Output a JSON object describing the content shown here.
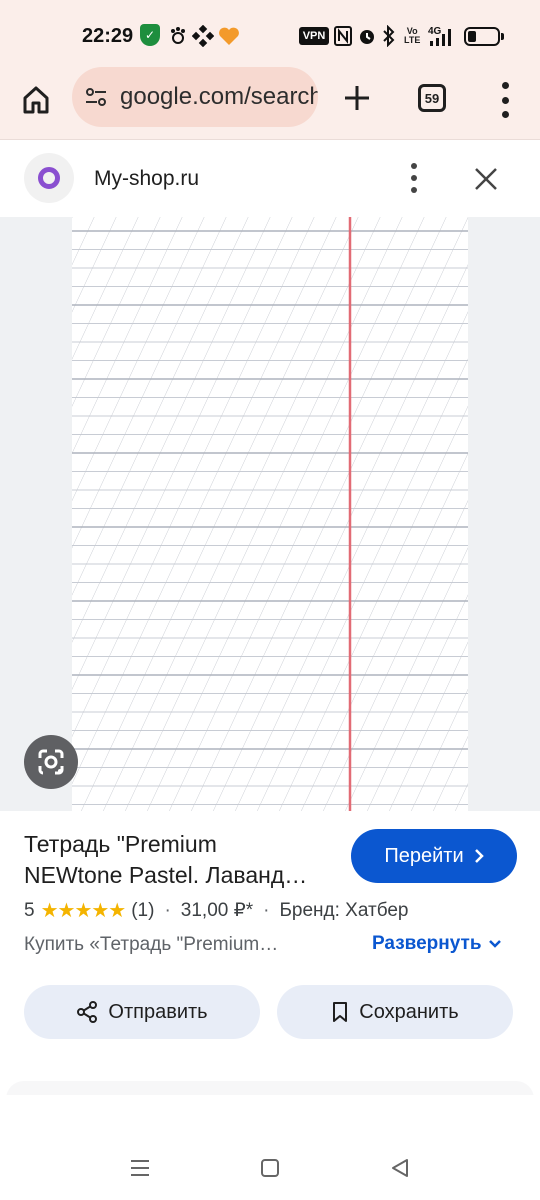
{
  "status_bar": {
    "time": "22:29",
    "vpn_label": "VPN",
    "icons": [
      "shield-icon",
      "pawprint-icon",
      "app-icon",
      "heart-icon",
      "nfc-icon",
      "alarm-icon",
      "bluetooth-icon",
      "volte-icon",
      "signal-4g-icon",
      "battery-icon"
    ],
    "network_label": "4G"
  },
  "toolbar": {
    "url": "google.com/search",
    "tab_count": "59"
  },
  "result": {
    "site_name": "My-shop.ru"
  },
  "product": {
    "title_line1": "Тетрадь \"Premium",
    "title_line2": "NEWtone Pastel. Лаванд…",
    "go_label": "Перейти",
    "rating": "5",
    "stars": "★★★★★",
    "review_count": "(1)",
    "price": "31,00 ₽*",
    "brand": "Бренд: Хатбер",
    "description": "Купить «Тетрадь \"Premium…",
    "expand_label": "Развернуть",
    "share_label": "Отправить",
    "save_label": "Сохранить"
  },
  "colors": {
    "accent": "#0b57d0",
    "status_bg": "#fbeeea",
    "margin_line": "#e26b75"
  }
}
